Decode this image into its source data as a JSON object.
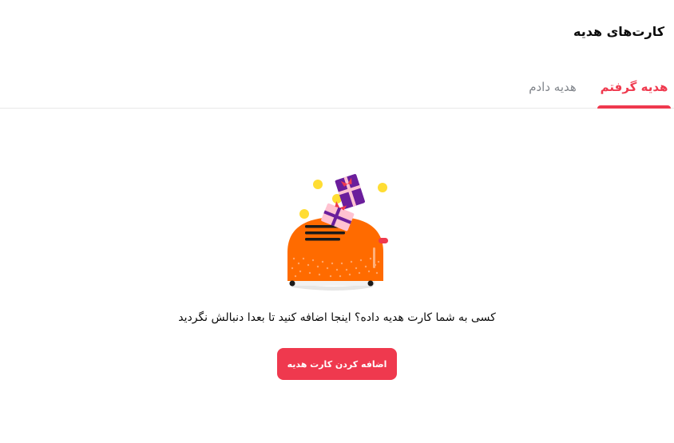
{
  "header": {
    "title": "کارت‌های هدیه"
  },
  "tabs": [
    {
      "label": "هدیه گرفتم",
      "active": true
    },
    {
      "label": "هدیه دادم",
      "active": false
    }
  ],
  "empty_state": {
    "illustration_icon": "gift-piggy-bank-icon",
    "message": "کسی به شما کارت هدیه داده؟ اینجا اضافه کنید تا بعدا دنبالش نگردید",
    "button_label": "اضافه کردن کارت هدیه"
  },
  "colors": {
    "accent": "#ef394e",
    "bank_orange": "#ff6b00",
    "gift_purple": "#6b1e9c",
    "gift_pink": "#ffc2d1",
    "coin_yellow": "#ffdd33"
  }
}
